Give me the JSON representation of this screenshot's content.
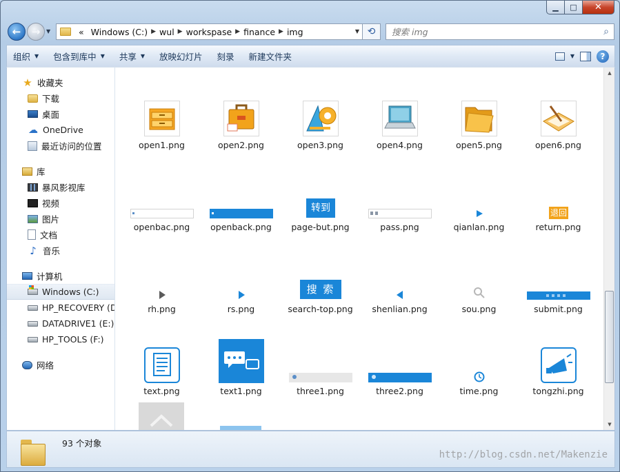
{
  "window": {
    "min": "▁",
    "max": "□",
    "close": "✕"
  },
  "address": {
    "prefix": "«",
    "crumbs": [
      "Windows (C:)",
      "wul",
      "workspase",
      "finance",
      "img"
    ]
  },
  "search": {
    "placeholder": "搜索 img"
  },
  "toolbar": [
    "组织",
    "包含到库中",
    "共享",
    "放映幻灯片",
    "刻录",
    "新建文件夹"
  ],
  "nav": {
    "favorites": {
      "label": "收藏夹",
      "items": [
        "下载",
        "桌面",
        "OneDrive",
        "最近访问的位置"
      ]
    },
    "libraries": {
      "label": "库",
      "items": [
        "暴风影视库",
        "视频",
        "图片",
        "文档",
        "音乐"
      ]
    },
    "computer": {
      "label": "计算机",
      "items": [
        "Windows  (C:)",
        "HP_RECOVERY (D:)",
        "DATADRIVE1 (E:)",
        "HP_TOOLS (F:)"
      ]
    },
    "network": {
      "label": "网络"
    }
  },
  "files": [
    "open1.png",
    "open2.png",
    "open3.png",
    "open4.png",
    "open5.png",
    "open6.png",
    "openbac.png",
    "openback.png",
    "page-but.png",
    "pass.png",
    "qianlan.png",
    "return.png",
    "rh.png",
    "rs.png",
    "search-top.png",
    "shenlian.png",
    "sou.png",
    "submit.png",
    "text.png",
    "text1.png",
    "three1.png",
    "three2.png",
    "time.png",
    "tongzhi.png"
  ],
  "thumb_text": {
    "page_but": "转到",
    "return": "退回",
    "search_top": "搜 索"
  },
  "status": {
    "count": "93 个对象"
  },
  "watermark": "http://blog.csdn.net/Makenzie",
  "colors": {
    "accent": "#1a86d8",
    "orange": "#f2a31b"
  }
}
